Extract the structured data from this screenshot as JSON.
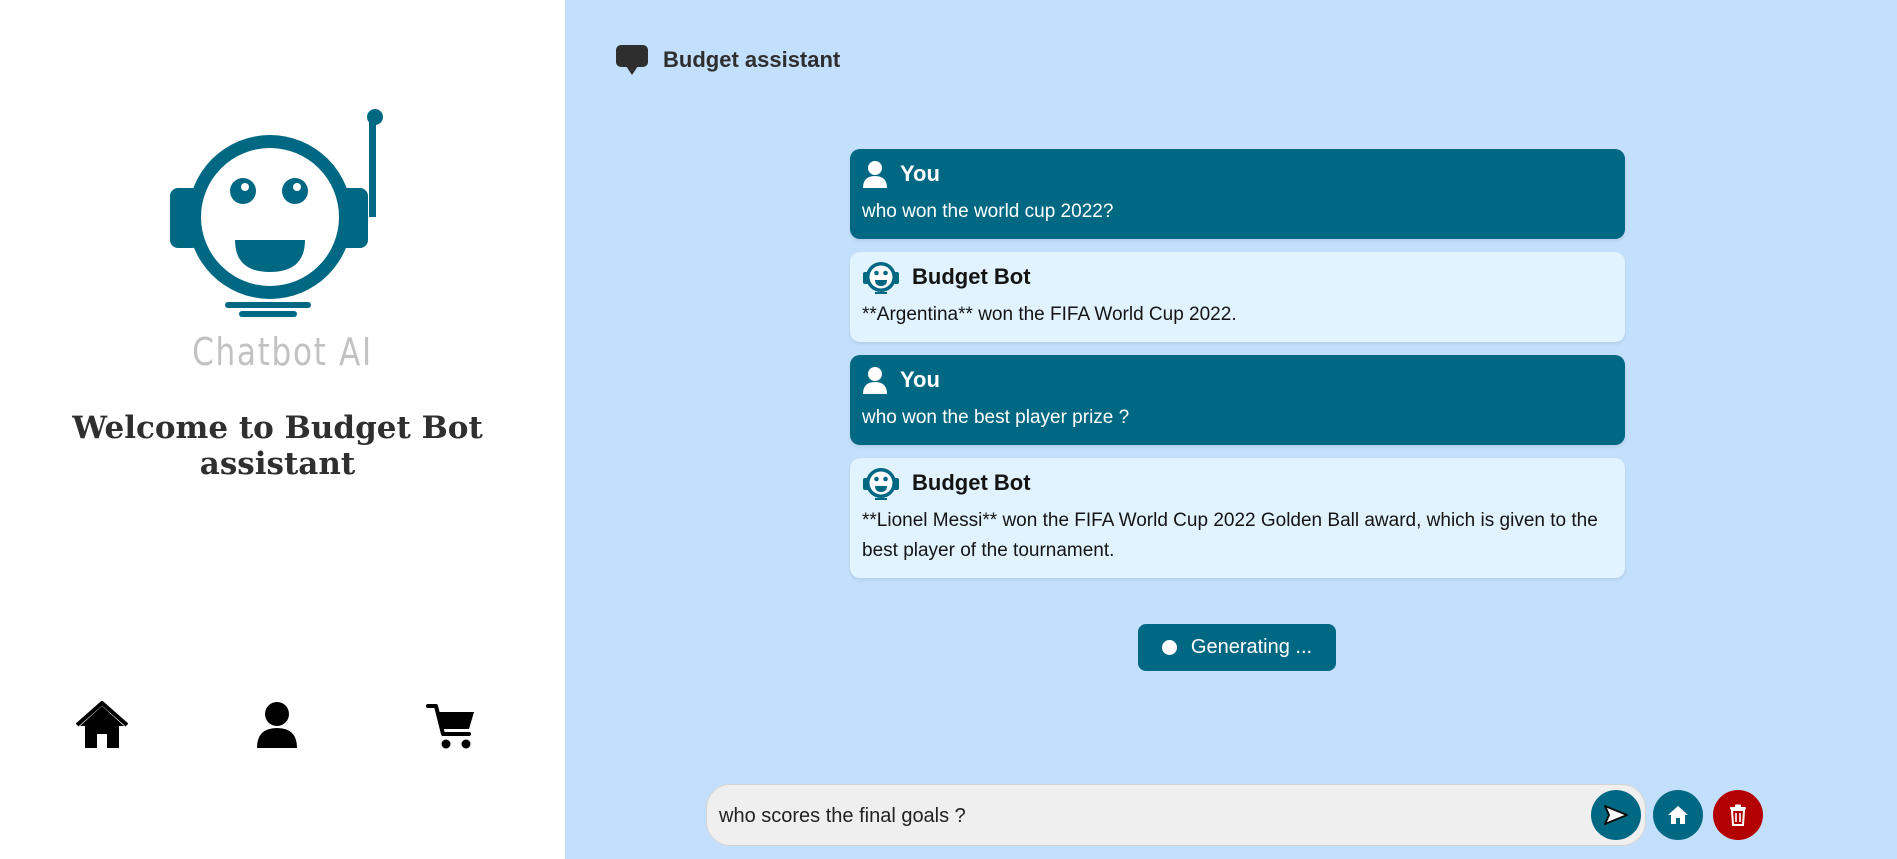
{
  "sidebar": {
    "logo_text": "Chatbot AI",
    "welcome": "Welcome to Budget Bot assistant",
    "nav": [
      {
        "icon": "home-icon"
      },
      {
        "icon": "user-icon"
      },
      {
        "icon": "cart-icon"
      }
    ]
  },
  "header": {
    "icon": "chat-bubble-icon",
    "title": "Budget assistant"
  },
  "messages": [
    {
      "role": "user",
      "name": "You",
      "text": "who won the world cup 2022?"
    },
    {
      "role": "bot",
      "name": "Budget Bot",
      "text": "**Argentina** won the FIFA World Cup 2022."
    },
    {
      "role": "user",
      "name": "You",
      "text": "who won the best player prize ?"
    },
    {
      "role": "bot",
      "name": "Budget Bot",
      "text": "**Lionel Messi** won the FIFA World Cup 2022 Golden Ball award, which is given to the best player of the tournament."
    }
  ],
  "status": {
    "generating_label": "Generating ..."
  },
  "composer": {
    "value": "who scores the final goals ?",
    "send_icon": "send-icon",
    "home_icon": "home-icon",
    "delete_icon": "trash-icon"
  },
  "colors": {
    "accent": "#006882",
    "chat_bg": "#c2dffb",
    "bot_bubble": "#e1f3fe",
    "delete": "#b30000"
  }
}
